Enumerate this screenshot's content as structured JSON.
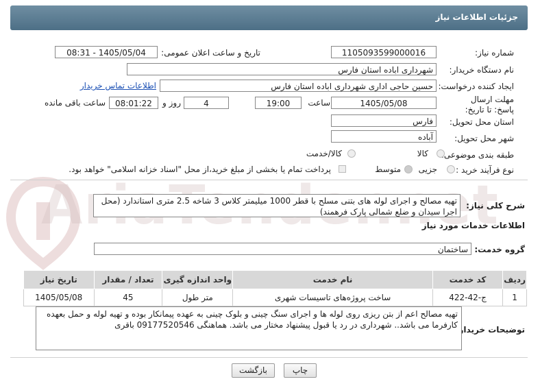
{
  "header": {
    "title": "جزئیات اطلاعات نیاز"
  },
  "form": {
    "need_number_label": "شماره نیاز:",
    "need_number": "1105093599000016",
    "announce_label": "تاریخ و ساعت اعلان عمومی:",
    "announce_value": "1405/05/04 - 08:31",
    "buyer_org_label": "نام دستگاه خریدار:",
    "buyer_org": "شهرداری اباده استان فارس",
    "creator_label": "ایجاد کننده درخواست:",
    "creator": "حسین حاجی اداری شهرداری اباده استان فارس",
    "contact_link": "اطلاعات تماس خریدار",
    "deadline_label": "مهلت ارسال پاسخ: تا تاریخ:",
    "deadline_date": "1405/05/08",
    "time_label": "ساعت",
    "deadline_time": "19:00",
    "days_value": "4",
    "days_label": "روز و",
    "remaining_time": "08:01:22",
    "remaining_label": "ساعت باقی مانده",
    "province_label": "استان محل تحویل:",
    "province": "فارس",
    "city_label": "شهر محل تحویل:",
    "city": "آباده",
    "category_label": "طبقه بندی موضوعی:",
    "category_options": [
      "کالا",
      "کالا/خدمت"
    ],
    "process_label": "نوع فرآیند خرید :",
    "process_options": [
      "جزیی",
      "متوسط"
    ],
    "payment_note": "پرداخت تمام یا بخشی از مبلغ خرید،از محل \"اسناد خزانه اسلامی\" خواهد بود."
  },
  "summary": {
    "label": "شرح کلی نیاز:",
    "text": "تهیه مصالح و اجرای لوله های بتنی مسلح با قطر 1000 میلیمتر کلاس 3 شاخه 2.5 متری استاندارد (محل اجرا سیدان و ضلع شمالی پارک فرهمند)"
  },
  "services": {
    "section_title": "اطلاعات خدمات مورد نیاز",
    "group_label": "گروه خدمت:",
    "group_value": "ساختمان",
    "columns": [
      "ردیف",
      "کد خدمت",
      "نام خدمت",
      "واحد اندازه گیری",
      "تعداد / مقدار",
      "تاریخ نیاز"
    ],
    "rows": [
      [
        "1",
        "ج-42-422",
        "ساخت پروژه‌های تاسیسات شهری",
        "متر طول",
        "45",
        "1405/05/08"
      ]
    ]
  },
  "buyer_notes": {
    "label": "توضیحات خریدار:",
    "text": "تهیه مصالح اعم از بتن ریزی روی لوله ها و اجرای سنگ چینی و بلوک چینی به عهده پیمانکار بوده و تهیه لوله و حمل بعهده کارفرما می باشد.. شهرداری در رد یا قبول پیشنهاد مختار می باشد. هماهنگی 09177520546 باقری"
  },
  "buttons": {
    "print": "چاپ",
    "back": "بازگشت"
  },
  "watermark": "AriaTender.net",
  "colors": {
    "header": "#5a7b91",
    "link": "#1a4fb4"
  }
}
